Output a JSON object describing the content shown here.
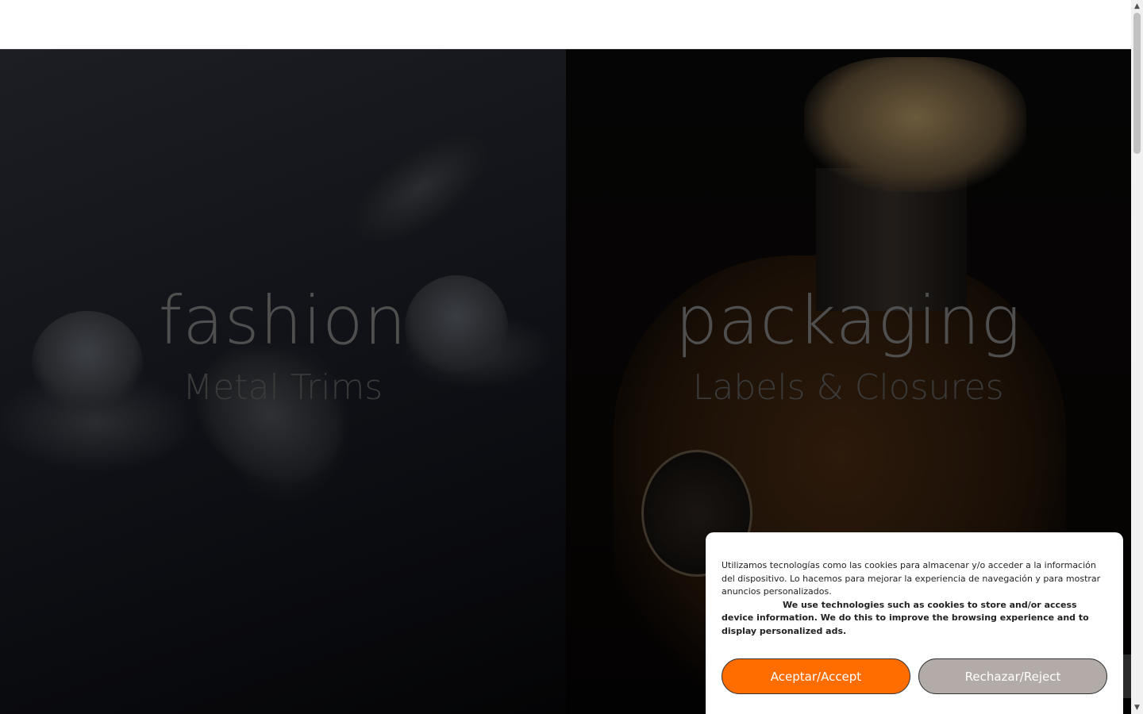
{
  "hero": {
    "left": {
      "title": "fashion",
      "subtitle": "Metal Trims"
    },
    "right": {
      "title": "packaging",
      "subtitle": "Labels & Closures"
    }
  },
  "cookie_banner": {
    "text_es": "Utilizamos tecnologías como las cookies para almacenar y/o acceder a la información del dispositivo. Lo hacemos para mejorar la experiencia de navegación y para mostrar anuncios personalizados.",
    "text_en": "We use technologies such as cookies to store and/or access device information. We do this to improve the browsing experience and to display personalized ads.",
    "accept_label": "Aceptar/Accept",
    "reject_label": "Rechazar/Reject"
  },
  "colors": {
    "accept_button": "#ff6d00",
    "reject_button": "#b3aba7",
    "hero_text": "#4f4f4f"
  },
  "icons": {
    "scroll_up": "triangle-up-icon",
    "scroll_down": "triangle-down-icon"
  }
}
